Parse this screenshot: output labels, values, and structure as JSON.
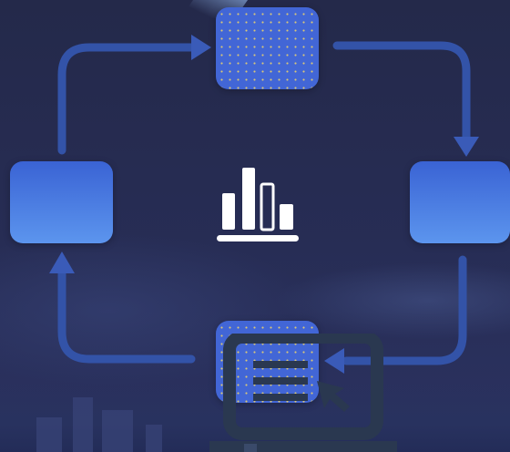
{
  "diagram": {
    "type": "cycle",
    "nodes": [
      {
        "id": "top",
        "label": ""
      },
      {
        "id": "right",
        "label": ""
      },
      {
        "id": "bottom",
        "label": ""
      },
      {
        "id": "left",
        "label": ""
      }
    ],
    "edges": [
      {
        "from": "left",
        "to": "top"
      },
      {
        "from": "top",
        "to": "right"
      },
      {
        "from": "right",
        "to": "bottom"
      },
      {
        "from": "bottom",
        "to": "left"
      }
    ],
    "icons": [
      "bar-chart-icon",
      "monitor-cursor-icon"
    ]
  },
  "colors": {
    "background": "#262b4f",
    "node": "#4266d6",
    "connector": "#3353a8",
    "icon_white": "#ffffff"
  }
}
